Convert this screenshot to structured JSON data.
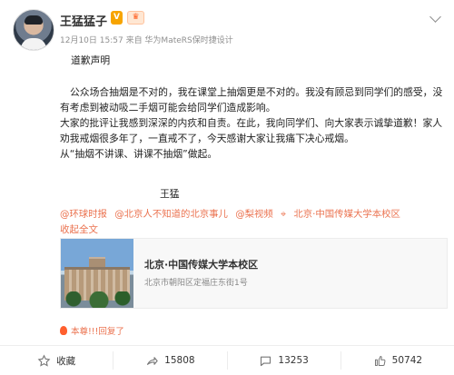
{
  "post": {
    "author": "王猛猛子",
    "meta": "12月10日 15:57 来自 华为MateRS保时捷设计",
    "title": "道歉声明",
    "body": [
      "公众场合抽烟是不对的，我在课堂上抽烟更是不对的。我没有顾忌到同学们的感受，没有考虑到被动吸二手烟可能会给同学们造成影响。",
      "大家的批评让我感到深深的内疚和自责。在此，我向同学们、向大家表示诚挚道歉！家人劝我戒烟很多年了，一直戒不了，今天感谢大家让我痛下决心戒烟。",
      "从“抽烟不讲课、讲课不抽烟”做起。"
    ],
    "signature": "王猛",
    "mentions": [
      "@环球时报",
      "@北京人不知道的北京事儿",
      "@梨视频",
      "北京·中国传媒大学本校区"
    ],
    "collapse": "收起全文",
    "card": {
      "title": "北京·中国传媒大学本校区",
      "address": "北京市朝阳区定福庄东街1号"
    },
    "reply": "本尊!!!回复了"
  },
  "actions": {
    "favorite": "收藏",
    "share": "15808",
    "comment": "13253",
    "like": "50742"
  },
  "icons": {
    "verified": "V",
    "level": "level-badge-icon",
    "location": "location-pin-icon",
    "favorite": "star-icon",
    "share": "share-icon",
    "comment": "comment-icon",
    "like": "thumb-up-icon",
    "more": "chevron-down-icon"
  },
  "colors": {
    "link": "#eb7350",
    "text": "#222222",
    "muted": "#8f8f8f",
    "verified": "#f7a400",
    "reply": "#eb7350"
  }
}
